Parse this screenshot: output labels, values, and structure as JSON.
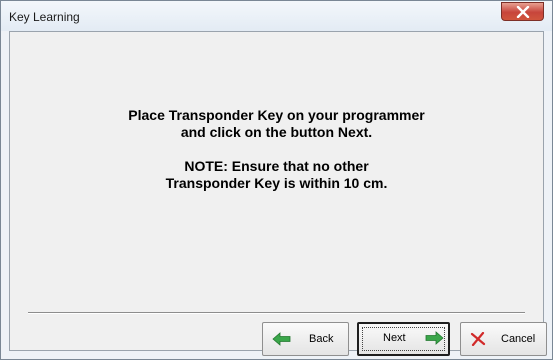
{
  "window": {
    "title": "Key Learning"
  },
  "message": {
    "line1": "Place Transponder Key on your programmer",
    "line2": "and click on the button Next.",
    "line3": "NOTE: Ensure that no other",
    "line4": "Transponder Key is within 10 cm."
  },
  "buttons": {
    "back_label": "Back",
    "next_label": "Next",
    "cancel_label": "Cancel"
  },
  "icons": {
    "close": "close-icon",
    "back": "arrow-left-icon",
    "next": "arrow-right-icon",
    "cancel": "cancel-x-icon"
  },
  "colors": {
    "close_button": "#c7453b",
    "arrow_green": "#3aa64a",
    "cancel_red": "#d12a2a"
  }
}
